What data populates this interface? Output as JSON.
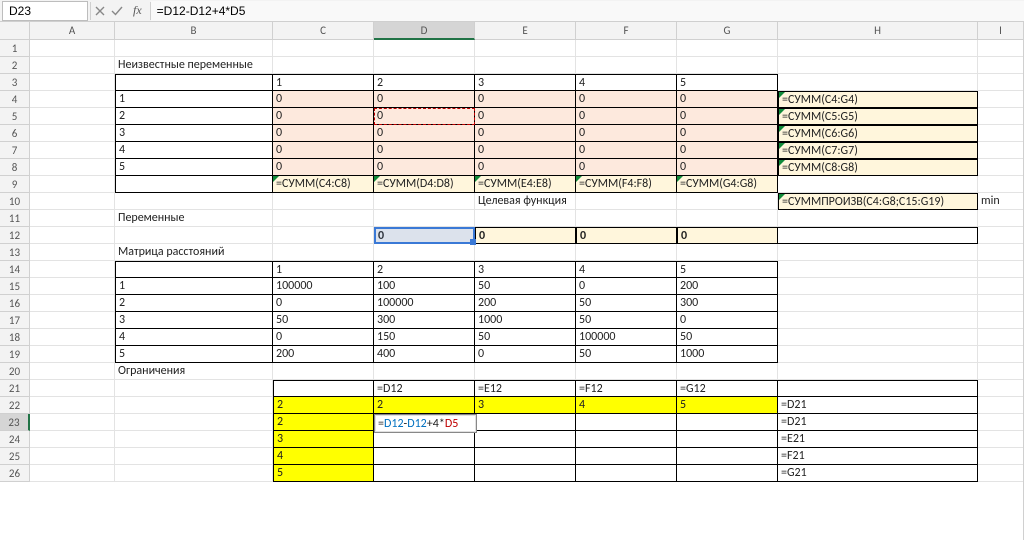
{
  "formula_bar": {
    "cell_ref": "D23",
    "fx_label": "fx",
    "formula": "=D12-D12+4*D5"
  },
  "columns": [
    "A",
    "B",
    "C",
    "D",
    "E",
    "F",
    "G",
    "H",
    "I"
  ],
  "col_widths": [
    "w-A",
    "w-B",
    "w-C",
    "w-D",
    "w-E",
    "w-F",
    "w-G",
    "w-H",
    "w-I"
  ],
  "selected_col": "D",
  "selected_row": 23,
  "row_count": 26,
  "edit": {
    "tokens": [
      {
        "text": "=",
        "cls": ""
      },
      {
        "text": "D12",
        "cls": "token-blue"
      },
      {
        "text": "-",
        "cls": ""
      },
      {
        "text": "D12",
        "cls": "token-blue"
      },
      {
        "text": "+4*",
        "cls": ""
      },
      {
        "text": "D5",
        "cls": "token-red"
      }
    ]
  },
  "labels": {
    "B2": "Неизвестные переменные",
    "B11": "Переменные",
    "B13": "Матрица расстояний",
    "B20": "Ограничения",
    "E10": "Целевая функция",
    "I10": "min"
  },
  "cells": {
    "C3": "1",
    "D3": "2",
    "E3": "3",
    "F3": "4",
    "G3": "5",
    "B4": "1",
    "B5": "2",
    "B6": "3",
    "B7": "4",
    "B8": "5",
    "C4": "0",
    "D4": "0",
    "E4": "0",
    "F4": "0",
    "G4": "0",
    "C5": "0",
    "D5": "0",
    "E5": "0",
    "F5": "0",
    "G5": "0",
    "C6": "0",
    "D6": "0",
    "E6": "0",
    "F6": "0",
    "G6": "0",
    "C7": "0",
    "D7": "0",
    "E7": "0",
    "F7": "0",
    "G7": "0",
    "C8": "0",
    "D8": "0",
    "E8": "0",
    "F8": "0",
    "G8": "0",
    "C9": "=СУММ(C4:C8)",
    "D9": "=СУММ(D4:D8)",
    "E9": "=СУММ(E4:E8)",
    "F9": "=СУММ(F4:F8)",
    "G9": "=СУММ(G4:G8)",
    "H4": "=СУММ(C4:G4)",
    "H5": "=СУММ(C5:G5)",
    "H6": "=СУММ(C6:G6)",
    "H7": "=СУММ(C7:G7)",
    "H8": "=СУММ(C8:G8)",
    "H10": "=СУММПРОИЗВ(C4:G8;C15:G19)",
    "D12": "0",
    "E12": "0",
    "F12": "0",
    "G12": "0",
    "C14": "1",
    "D14": "2",
    "E14": "3",
    "F14": "4",
    "G14": "5",
    "B15": "1",
    "B16": "2",
    "B17": "3",
    "B18": "4",
    "B19": "5",
    "C15": "100000",
    "D15": "100",
    "E15": "50",
    "F15": "0",
    "G15": "200",
    "C16": "0",
    "D16": "100000",
    "E16": "200",
    "F16": "50",
    "G16": "300",
    "C17": "50",
    "D17": "300",
    "E17": "1000",
    "F17": "50",
    "G17": "0",
    "C18": "0",
    "D18": "150",
    "E18": "50",
    "F18": "100000",
    "G18": "50",
    "C19": "200",
    "D19": "400",
    "E19": "0",
    "F19": "50",
    "G19": "1000",
    "D21": "=D12",
    "E21": "=E12",
    "F21": "=F12",
    "G21": "=G12",
    "C22": "2",
    "D22": "2",
    "E22": "3",
    "F22": "4",
    "G22": "5",
    "C23": "2",
    "C24": "3",
    "C25": "4",
    "C26": "5",
    "H22": "=D21",
    "H23": "=D21",
    "H24": "=E21",
    "H25": "=F21",
    "H26": "=G21"
  }
}
